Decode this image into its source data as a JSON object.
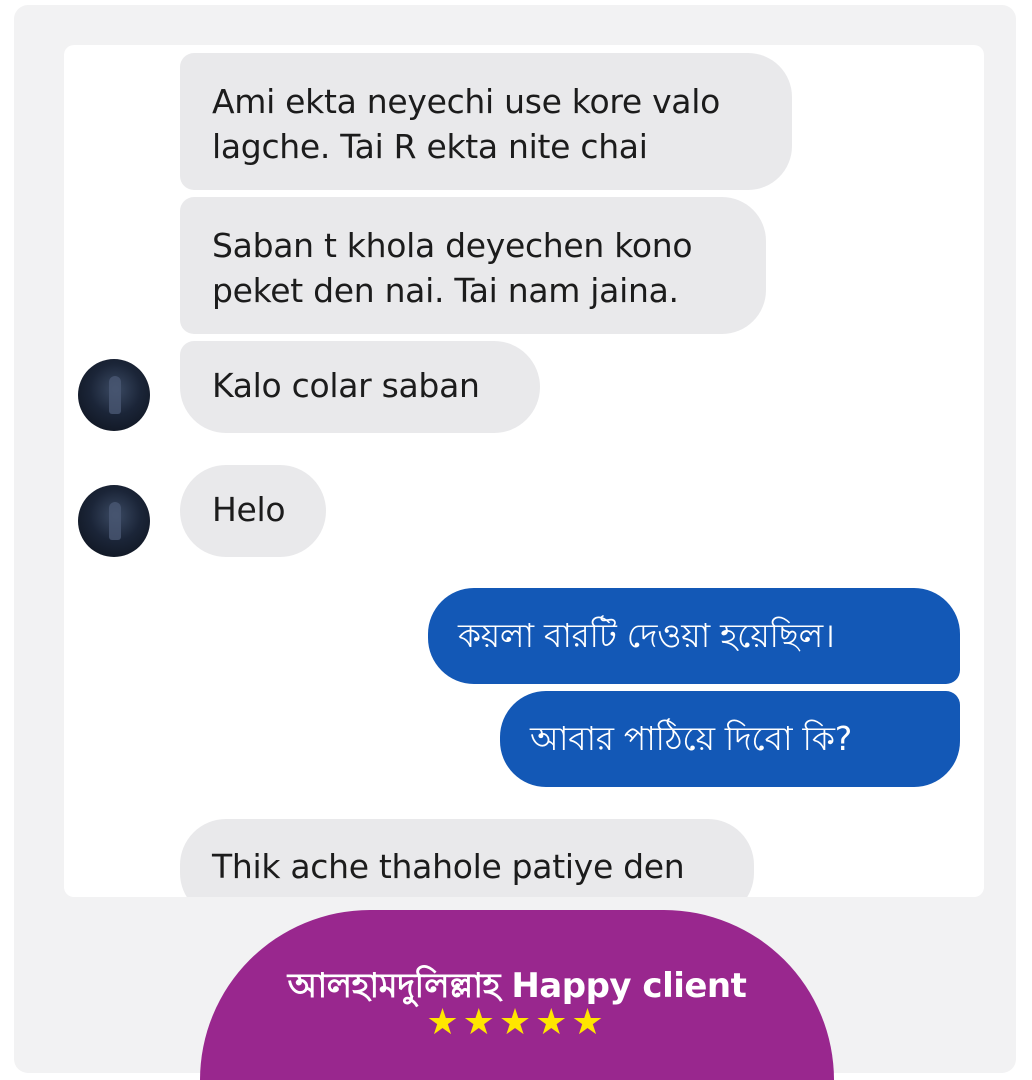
{
  "messages": [
    {
      "side": "in",
      "text": "Ami ekta neyechi use kore valo\nlagche. Tai R ekta nite chai"
    },
    {
      "side": "in",
      "text": "Saban t khola deyechen kono\npeket den nai. Tai nam jaina."
    },
    {
      "side": "in",
      "text": "Kalo colar saban"
    },
    {
      "side": "in",
      "text": "Helo"
    },
    {
      "side": "out",
      "text": "কয়লা বারটি দেওয়া হয়েছিল।"
    },
    {
      "side": "out",
      "text": "আবার পাঠিয়ে দিবো কি?"
    },
    {
      "side": "in",
      "text": "Thik ache thahole patiye den"
    }
  ],
  "banner": {
    "title": "আলহামদুলিল্লাহ Happy client",
    "stars": "★★★★★",
    "rating": 5,
    "color": "#99278e"
  },
  "colors": {
    "incoming_bubble": "#e9e9eb",
    "outgoing_bubble": "#1358b6",
    "star": "#ffe600"
  }
}
